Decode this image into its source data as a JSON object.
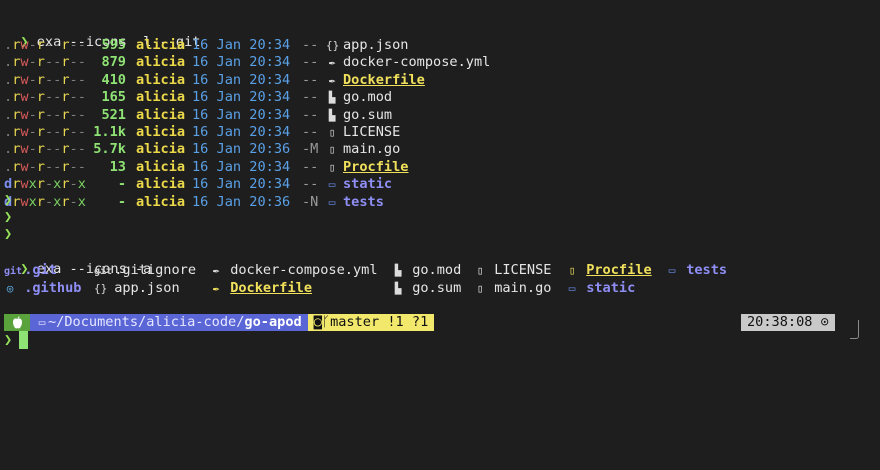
{
  "cmd1": {
    "prompt": "❯",
    "text": "exa --icons -l --git"
  },
  "listing": [
    {
      "perm": [
        ".",
        "r",
        "w",
        "-",
        "r",
        "-",
        "-",
        "r",
        "-",
        "-"
      ],
      "size": "595",
      "user": "alicia",
      "date": "16 Jan 20:34",
      "git": "--",
      "icon": "{}",
      "icon_name": "json-icon",
      "name": "app.json",
      "style": "normal"
    },
    {
      "perm": [
        ".",
        "r",
        "w",
        "-",
        "r",
        "-",
        "-",
        "r",
        "-",
        "-"
      ],
      "size": "879",
      "user": "alicia",
      "date": "16 Jan 20:34",
      "git": "--",
      "icon": "✒",
      "icon_name": "docker-icon",
      "name": "docker-compose.yml",
      "style": "normal"
    },
    {
      "perm": [
        ".",
        "r",
        "w",
        "-",
        "r",
        "-",
        "-",
        "r",
        "-",
        "-"
      ],
      "size": "410",
      "user": "alicia",
      "date": "16 Jan 20:34",
      "git": "--",
      "icon": "✒",
      "icon_name": "docker-icon",
      "name": "Dockerfile",
      "style": "hl"
    },
    {
      "perm": [
        ".",
        "r",
        "w",
        "-",
        "r",
        "-",
        "-",
        "r",
        "-",
        "-"
      ],
      "size": "165",
      "user": "alicia",
      "date": "16 Jan 20:34",
      "git": "--",
      "icon": "▙",
      "icon_name": "file-icon",
      "name": "go.mod",
      "style": "normal"
    },
    {
      "perm": [
        ".",
        "r",
        "w",
        "-",
        "r",
        "-",
        "-",
        "r",
        "-",
        "-"
      ],
      "size": "521",
      "user": "alicia",
      "date": "16 Jan 20:34",
      "git": "--",
      "icon": "▙",
      "icon_name": "file-icon",
      "name": "go.sum",
      "style": "normal"
    },
    {
      "perm": [
        ".",
        "r",
        "w",
        "-",
        "r",
        "-",
        "-",
        "r",
        "-",
        "-"
      ],
      "size": "1.1k",
      "user": "alicia",
      "date": "16 Jan 20:34",
      "git": "--",
      "icon": "▯",
      "icon_name": "document-icon",
      "name": "LICENSE",
      "style": "normal"
    },
    {
      "perm": [
        ".",
        "r",
        "w",
        "-",
        "r",
        "-",
        "-",
        "r",
        "-",
        "-"
      ],
      "size": "5.7k",
      "user": "alicia",
      "date": "16 Jan 20:36",
      "git": "-M",
      "icon": "▯",
      "icon_name": "go-file-icon",
      "name": "main.go",
      "style": "normal"
    },
    {
      "perm": [
        ".",
        "r",
        "w",
        "-",
        "r",
        "-",
        "-",
        "r",
        "-",
        "-"
      ],
      "size": "13",
      "user": "alicia",
      "date": "16 Jan 20:34",
      "git": "--",
      "icon": "▯",
      "icon_name": "procfile-icon",
      "name": "Procfile",
      "style": "hl"
    },
    {
      "perm": [
        "d",
        "r",
        "w",
        "x",
        "r",
        "-",
        "x",
        "r",
        "-",
        "x"
      ],
      "size": "-",
      "user": "alicia",
      "date": "16 Jan 20:34",
      "git": "--",
      "icon": "▭",
      "icon_name": "folder-icon",
      "name": "static",
      "style": "dir"
    },
    {
      "perm": [
        "d",
        "r",
        "w",
        "x",
        "r",
        "-",
        "x",
        "r",
        "-",
        "x"
      ],
      "size": "-",
      "user": "alicia",
      "date": "16 Jan 20:36",
      "git": "-N",
      "icon": "▭",
      "icon_name": "folder-icon",
      "name": "tests",
      "style": "dir"
    }
  ],
  "empty_prompts": [
    "❯",
    "❯",
    "❯"
  ],
  "cmd2": {
    "prompt": "❯",
    "text": "exa --icons -a"
  },
  "grid": [
    {
      "icon": "git",
      "icon_name": "git-icon",
      "name": ".git",
      "style": "dir",
      "ico": "ico-gitb"
    },
    {
      "icon": "git",
      "icon_name": "git-icon",
      "name": ".gitignore",
      "style": "normal",
      "ico": "ico-git"
    },
    {
      "icon": "✒",
      "icon_name": "docker-icon",
      "name": "docker-compose.yml",
      "style": "normal",
      "ico": "ico-file"
    },
    {
      "icon": "▙",
      "icon_name": "file-icon",
      "name": "go.mod",
      "style": "normal",
      "ico": "ico-file"
    },
    {
      "icon": "▯",
      "icon_name": "document-icon",
      "name": "LICENSE",
      "style": "normal",
      "ico": "ico-doc"
    },
    {
      "icon": "▯",
      "icon_name": "procfile-icon",
      "name": "Procfile",
      "style": "hl",
      "ico": "ico-pen"
    },
    {
      "icon": "▭",
      "icon_name": "folder-icon",
      "name": "tests",
      "style": "dir",
      "ico": "ico-dir"
    },
    {
      "icon": "◎",
      "icon_name": "github-icon",
      "name": ".github",
      "style": "dir",
      "ico": "ico-gh"
    },
    {
      "icon": "{}",
      "icon_name": "json-icon",
      "name": "app.json",
      "style": "normal",
      "ico": "ico-file"
    },
    {
      "icon": "✒",
      "icon_name": "docker-icon",
      "name": "Dockerfile",
      "style": "hl",
      "ico": "ico-pen"
    },
    {
      "icon": "▙",
      "icon_name": "file-icon",
      "name": "go.sum",
      "style": "normal",
      "ico": "ico-file"
    },
    {
      "icon": "▯",
      "icon_name": "go-file-icon",
      "name": "main.go",
      "style": "normal",
      "ico": "ico-doc"
    },
    {
      "icon": "▭",
      "icon_name": "folder-icon",
      "name": "static",
      "style": "dir",
      "ico": "ico-dir"
    }
  ],
  "statusbar": {
    "os_icon": "",
    "folder_icon": "▭",
    "path_prefix": "~/Documents/alicia-code/",
    "path_current": "go-apod",
    "git_icon": "◙",
    "branch_icon": "ᚴ",
    "branch": "master !1 ?1",
    "time": "20:38:08",
    "clock_icon": "⊙"
  },
  "current_prompt": "❯"
}
